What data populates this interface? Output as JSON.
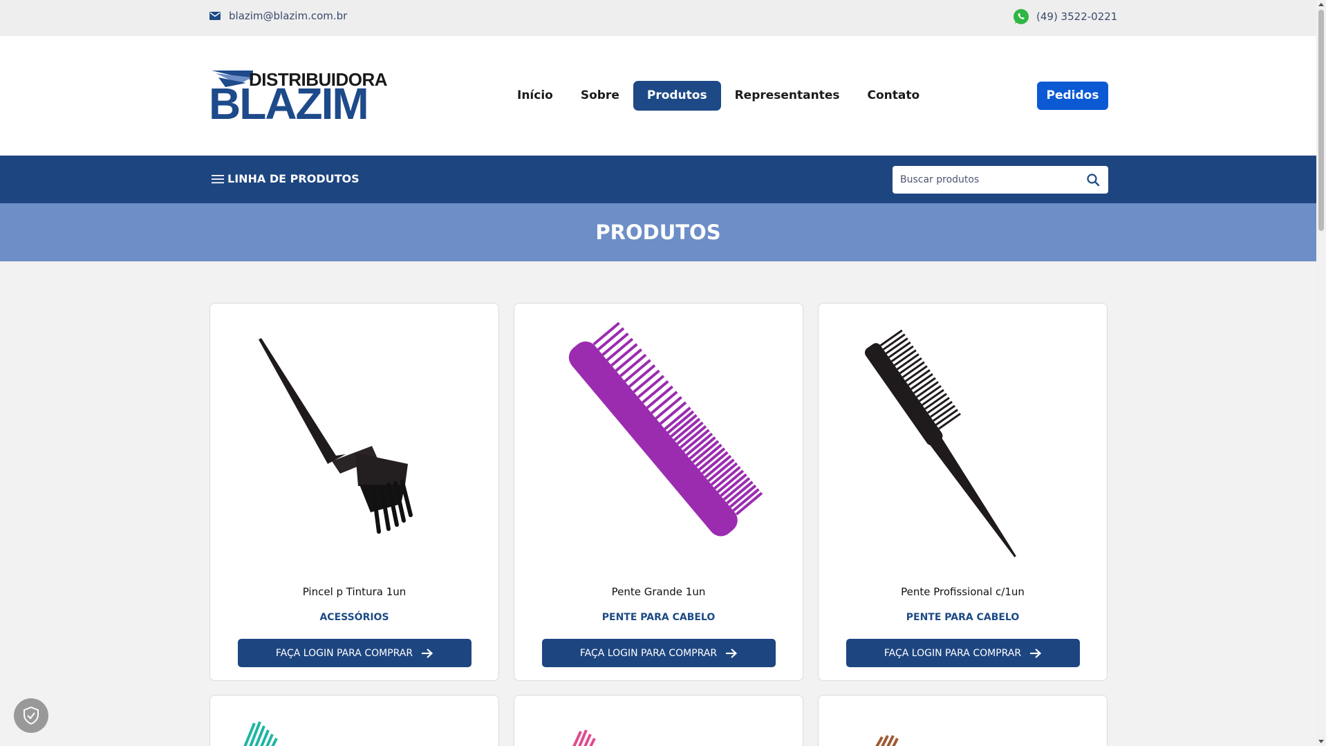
{
  "topbar": {
    "email": "blazim@blazim.com.br",
    "phone": "(49) 3522-0221"
  },
  "logo": {
    "top_text": "DISTRIBUIDORA",
    "main_text": "BLAZIM"
  },
  "nav": {
    "items": [
      "Início",
      "Sobre",
      "Produtos",
      "Representantes",
      "Contato"
    ],
    "active": "Produtos"
  },
  "pedidos_label": "Pedidos",
  "category_menu_label": "LINHA DE PRODUTOS",
  "search": {
    "placeholder": "Buscar produtos"
  },
  "page_title": "PRODUTOS",
  "products": [
    {
      "name": "Pincel p Tintura 1un",
      "category": "ACESSÓRIOS",
      "button": "FAÇA LOGIN PARA COMPRAR",
      "color": "#1f1a1c"
    },
    {
      "name": "Pente Grande 1un",
      "category": "PENTE PARA CABELO",
      "button": "FAÇA LOGIN PARA COMPRAR",
      "color": "#9b2cb0"
    },
    {
      "name": "Pente Profissional c/1un",
      "category": "PENTE PARA CABELO",
      "button": "FAÇA LOGIN PARA COMPRAR",
      "color": "#1f1a1c"
    }
  ],
  "partial_products_colors": [
    "#1fb5a3",
    "#e04a8e",
    "#a05a35"
  ],
  "colors": {
    "primary": "#1d4580",
    "accent": "#0b5ad4",
    "title_bar": "#6d8ec7"
  }
}
